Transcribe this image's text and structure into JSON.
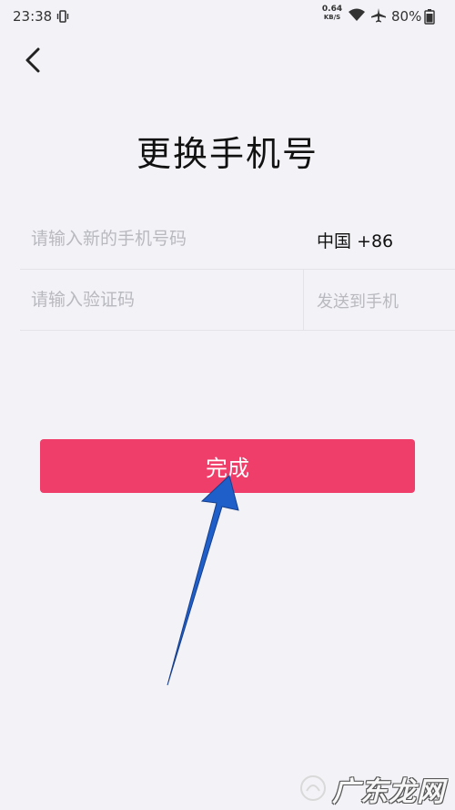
{
  "status_bar": {
    "time": "23:38",
    "net_speed_value": "0.64",
    "net_speed_unit": "KB/S",
    "battery": "80%"
  },
  "title": "更换手机号",
  "phone_field": {
    "placeholder": "请输入新的手机号码",
    "country_code": "中国 +86"
  },
  "code_field": {
    "placeholder": "请输入验证码",
    "send_label": "发送到手机"
  },
  "submit_label": "完成",
  "watermark": "广东龙网",
  "colors": {
    "background": "#f3f3f7",
    "accent": "#f03e6b",
    "arrow": "#1f5fc9",
    "placeholder": "#b8b8bf"
  },
  "icons": [
    "vibrate-icon",
    "wifi-icon",
    "airplane-icon",
    "battery-icon",
    "back-arrow-icon",
    "pointer-arrow-icon"
  ]
}
